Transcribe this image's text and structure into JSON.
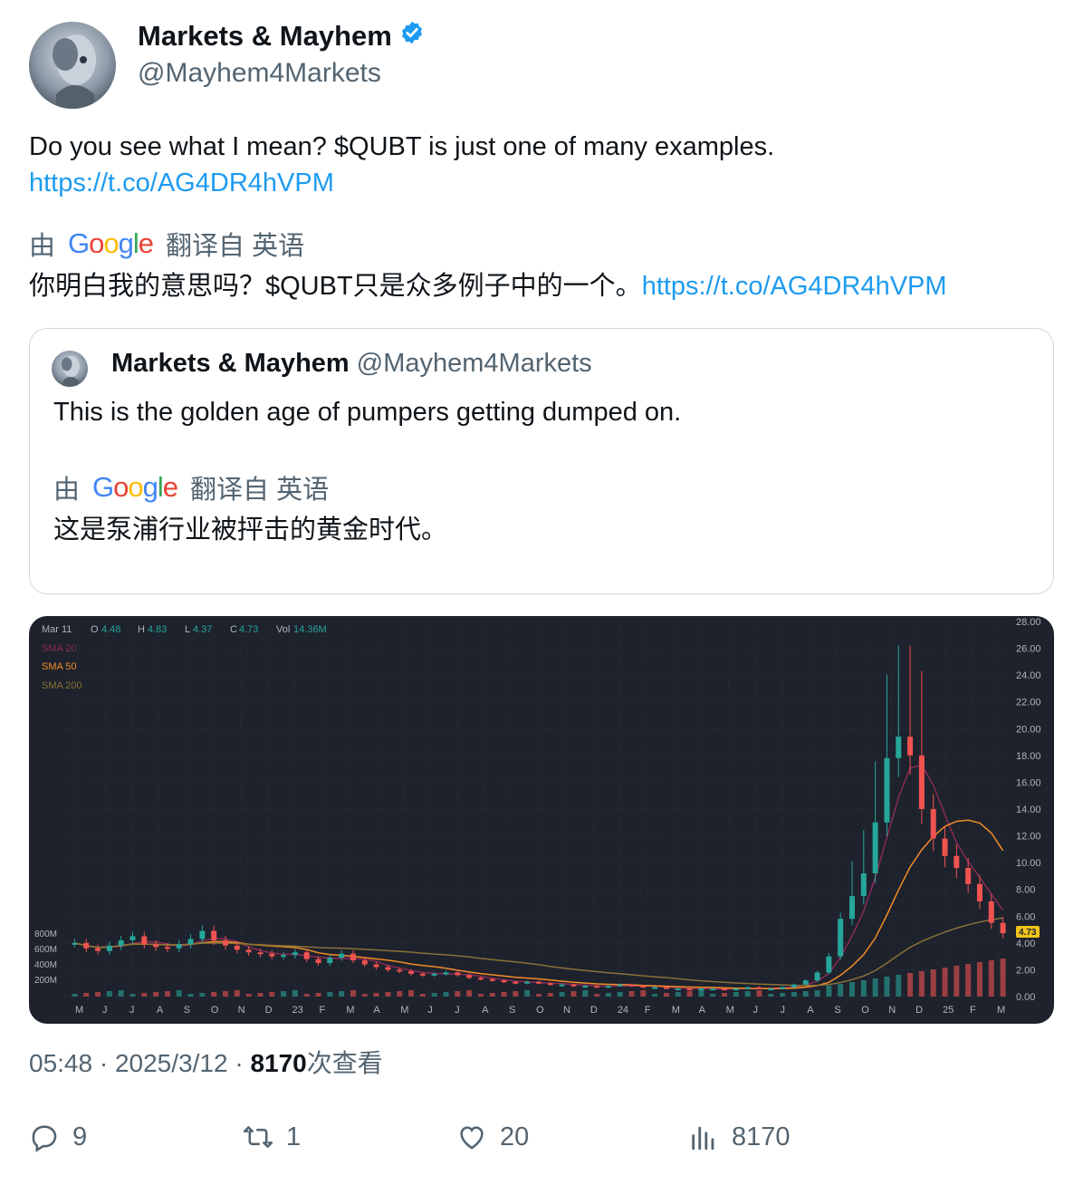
{
  "author": {
    "name": "Markets & Mayhem",
    "handle": "@Mayhem4Markets",
    "verified": true
  },
  "tweet": {
    "text": "Do you see what I mean? $QUBT is just one of many examples.",
    "link": "https://t.co/AG4DR4hVPM",
    "translation_by": "由",
    "translation_brand": "Google",
    "translation_from": "翻译自 英语",
    "translated_text": "你明白我的意思吗？$QUBT只是众多例子中的一个。",
    "translated_link": "https://t.co/AG4DR4hVPM"
  },
  "quote": {
    "name": "Markets & Mayhem",
    "handle": "@Mayhem4Markets",
    "text": "This is the golden age of pumpers getting dumped on.",
    "translation_by": "由",
    "translation_brand": "Google",
    "translation_from": "翻译自 英语",
    "translated_text": "这是泵浦行业被抨击的黄金时代。"
  },
  "chart_data": {
    "type": "candlestick",
    "header": {
      "date": "Mar 11",
      "o_label": "O",
      "o": "4.48",
      "h_label": "H",
      "h": "4.83",
      "l_label": "L",
      "l": "4.37",
      "c_label": "C",
      "c": "4.73",
      "vol_label": "Vol",
      "vol": "14.36M"
    },
    "legend": [
      {
        "name": "SMA 20",
        "color": "#8b2a57"
      },
      {
        "name": "SMA 50",
        "color": "#f28c28"
      },
      {
        "name": "SMA 200",
        "color": "#8a7236"
      }
    ],
    "y_ticks": [
      "28.00",
      "26.00",
      "24.00",
      "22.00",
      "20.00",
      "18.00",
      "16.00",
      "14.00",
      "12.00",
      "10.00",
      "8.00",
      "6.00",
      "4.00",
      "2.00",
      "0.00"
    ],
    "vol_ticks": [
      "800M",
      "600M",
      "400M",
      "200M"
    ],
    "x_ticks": [
      "M",
      "J",
      "J",
      "A",
      "S",
      "O",
      "N",
      "D",
      "23",
      "F",
      "M",
      "A",
      "M",
      "J",
      "J",
      "A",
      "S",
      "O",
      "N",
      "D",
      "24",
      "F",
      "M",
      "A",
      "M",
      "J",
      "J",
      "A",
      "S",
      "O",
      "N",
      "D",
      "25",
      "F",
      "M"
    ],
    "last_price": "4.73",
    "y_range": [
      0,
      28
    ],
    "close_series": [
      4.0,
      3.6,
      3.4,
      3.8,
      4.2,
      4.5,
      3.9,
      3.7,
      3.6,
      3.9,
      4.3,
      4.9,
      4.2,
      3.8,
      3.5,
      3.3,
      3.2,
      3.0,
      3.1,
      3.3,
      2.8,
      2.5,
      2.9,
      3.2,
      2.7,
      2.4,
      2.2,
      2.0,
      1.9,
      1.7,
      1.6,
      1.7,
      1.8,
      1.6,
      1.4,
      1.3,
      1.2,
      1.1,
      1.0,
      1.1,
      1.0,
      0.9,
      0.9,
      0.8,
      0.8,
      0.7,
      0.8,
      0.9,
      0.8,
      0.7,
      0.7,
      0.6,
      0.6,
      0.5,
      0.6,
      0.6,
      0.5,
      0.6,
      0.7,
      0.6,
      0.6,
      0.7,
      0.9,
      1.2,
      1.8,
      3.0,
      5.8,
      7.5,
      9.2,
      13.0,
      17.8,
      19.4,
      18.0,
      14.0,
      11.8,
      10.5,
      9.6,
      8.4,
      7.1,
      5.5,
      4.73
    ],
    "grid": true
  },
  "footer": {
    "time": "05:48",
    "dot": "·",
    "date": "2025/3/12",
    "views_count": "8170",
    "views_label": "次查看"
  },
  "actions": {
    "replies": "9",
    "retweets": "1",
    "likes": "20",
    "views": "8170"
  }
}
